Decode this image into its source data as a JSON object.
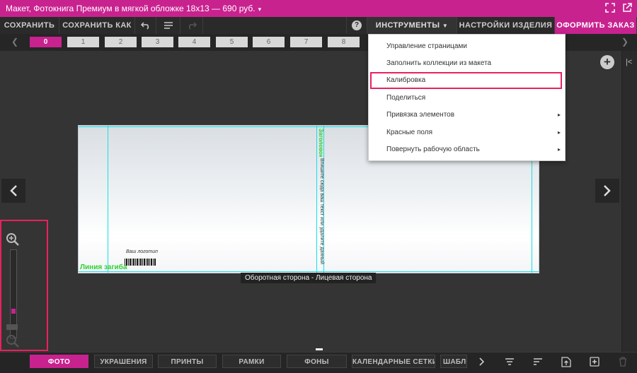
{
  "titlebar": {
    "title": "Макет, Фотокнига Премиум в мягкой обложке 18х13  — 690 руб.",
    "caret": "▾",
    "icons": [
      "fullscreen-icon",
      "open-external-icon"
    ]
  },
  "toolbar": {
    "save_label": "СОХРАНИТЬ",
    "save_as_label": "СОХРАНИТЬ КАК",
    "help": "?",
    "tools_label": "ИНСТРУМЕНТЫ",
    "product_settings_label": "НАСТРОЙКИ ИЗДЕЛИЯ",
    "checkout_label": "ОФОРМИТЬ ЗАКАЗ"
  },
  "pages": [
    "0",
    "1",
    "2",
    "3",
    "4",
    "5",
    "6",
    "7",
    "8"
  ],
  "active_page": "0",
  "menu": {
    "items": [
      {
        "label": "Управление страницами",
        "submenu": false
      },
      {
        "label": "Заполнить коллекции из макета",
        "submenu": false
      },
      {
        "label": "Калибровка",
        "submenu": false,
        "highlighted": true
      },
      {
        "label": "Поделиться",
        "submenu": false
      },
      {
        "label": "Привязка элементов",
        "submenu": true
      },
      {
        "label": "Красные поля",
        "submenu": true
      },
      {
        "label": "Повернуть рабочую область",
        "submenu": true
      }
    ],
    "submenu_arrow": "▸"
  },
  "spread": {
    "fold_label": "Линия загиба",
    "spine_title": "Заголовок",
    "spine_text": "Впишите сюда ваш текст или удалите данный",
    "publisher": "Ваш логотип",
    "caption": "Оборотная сторона - Лицевая сторона"
  },
  "bottom_tabs": [
    "ФОТО",
    "УКРАШЕНИЯ",
    "ПРИНТЫ",
    "РАМКИ",
    "ФОНЫ",
    "КАЛЕНДАРНЫЕ СЕТКИ",
    "ШАБЛОНЫ"
  ],
  "active_tab": "ФОТО",
  "colors": {
    "accent": "#c8228f",
    "highlight_border": "#e8215f",
    "guide": "#16e0e6",
    "fold_text": "#2fd12f"
  }
}
